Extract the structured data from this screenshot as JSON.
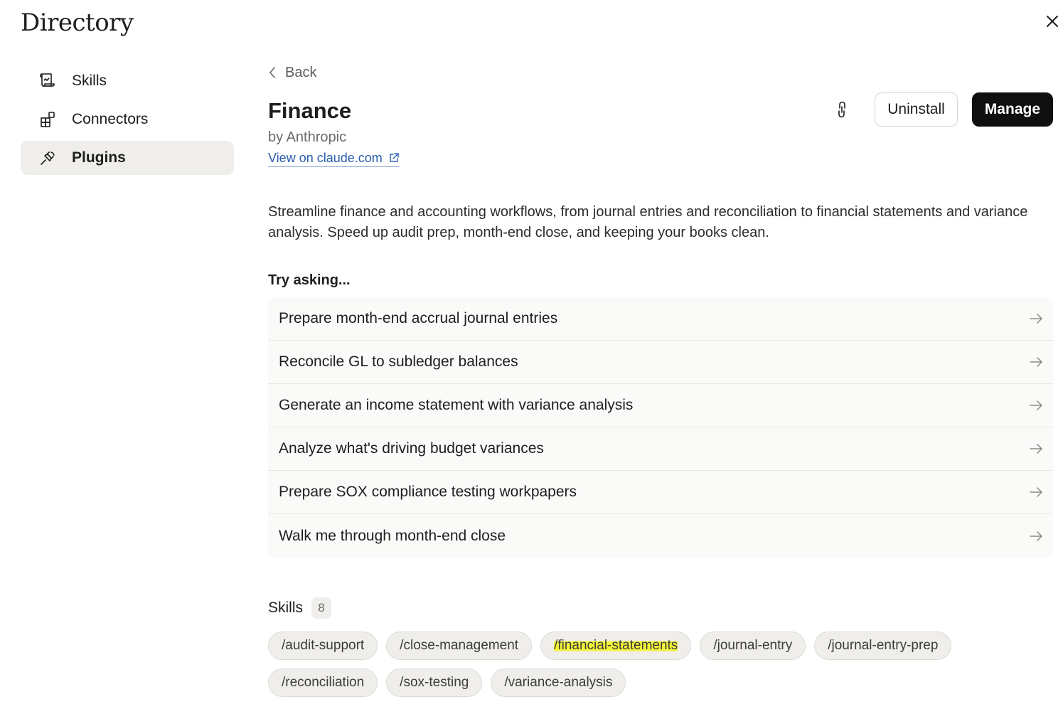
{
  "page": {
    "title": "Directory"
  },
  "sidebar": {
    "items": [
      {
        "label": "Skills",
        "icon": "skills-icon",
        "active": false
      },
      {
        "label": "Connectors",
        "icon": "connectors-icon",
        "active": false
      },
      {
        "label": "Plugins",
        "icon": "plug-icon",
        "active": true
      }
    ]
  },
  "main": {
    "back_label": "Back",
    "plugin": {
      "name": "Finance",
      "author": "by Anthropic",
      "view_link": "View on claude.com"
    },
    "actions": {
      "uninstall_label": "Uninstall",
      "manage_label": "Manage"
    },
    "description": "Streamline finance and accounting workflows, from journal entries and reconciliation to financial statements and variance analysis. Speed up audit prep, month-end close, and keeping your books clean.",
    "try_heading": "Try asking...",
    "prompts": [
      "Prepare month-end accrual journal entries",
      "Reconcile GL to subledger balances",
      "Generate an income statement with variance analysis",
      "Analyze what's driving budget variances",
      "Prepare SOX compliance testing workpapers",
      "Walk me through month-end close"
    ],
    "skills": {
      "heading": "Skills",
      "count": "8",
      "chips": [
        "/audit-support",
        "/close-management",
        "/financial-statements",
        "/journal-entry",
        "/journal-entry-prep",
        "/reconciliation",
        "/sox-testing",
        "/variance-analysis"
      ],
      "highlight_color": "#f5f53a"
    }
  }
}
